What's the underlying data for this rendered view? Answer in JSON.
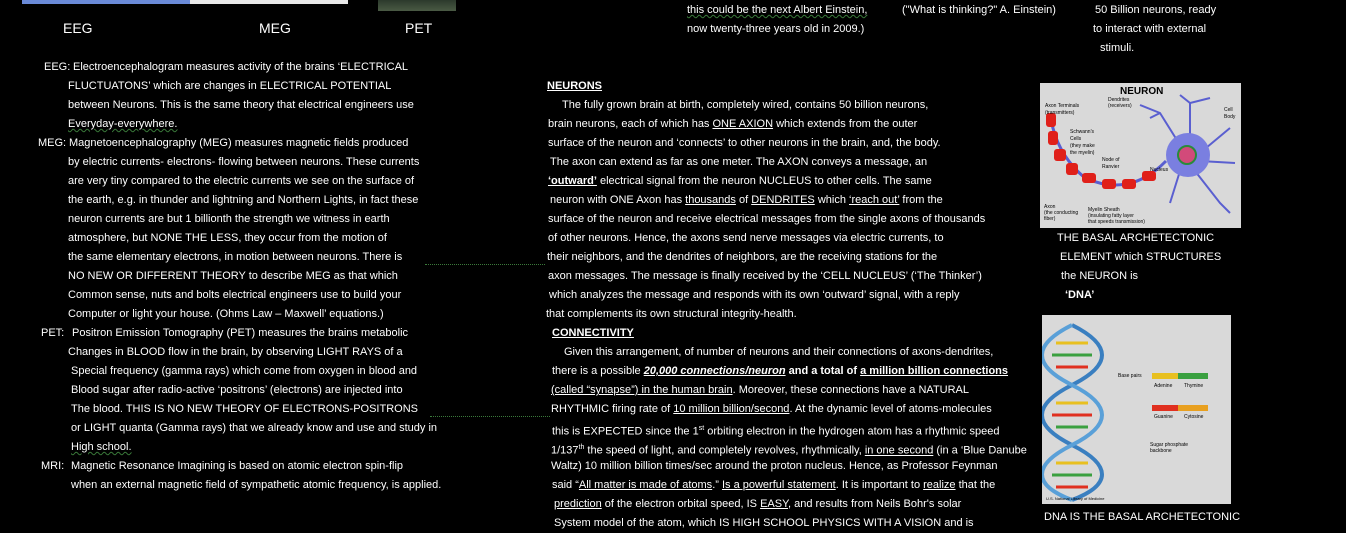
{
  "top_images": {
    "eeg_label": "EEG",
    "meg_label": "MEG",
    "pet_label": "PET"
  },
  "top_quotes": {
    "col1": [
      "this could be the next Albert Einstein,",
      "now twenty-three years old in 2009.)"
    ],
    "col2": [
      "(\"What is thinking?\" A. Einstein)"
    ],
    "col3": [
      "50 Billion neurons, ready",
      "to interact with external",
      "stimuli."
    ]
  },
  "left_column": {
    "eeg": {
      "prefix": "EEG:",
      "lines": [
        "Electroencephalogram measures activity of the brains ‘ELECTRICAL",
        "FLUCTUATONS’ which are changes in ELECTRICAL POTENTIAL",
        "between Neurons.  This is the same theory that electrical engineers use",
        "Everyday-everywhere."
      ]
    },
    "meg": {
      "prefix": "MEG:",
      "lines": [
        "Magnetoencephalography (MEG) measures magnetic fields produced",
        "by electric currents- electrons- flowing between neurons.  These currents",
        "are very tiny compared to the electric currents we see on the surface of",
        "the earth, e.g. in thunder and lightning and Northern Lights, in fact these",
        "neuron currents are but 1 billionth the strength we witness in earth",
        "atmosphere, but NONE THE LESS, they occur from the motion of",
        "the same  elementary electrons, in motion between neurons.  There is",
        "NO NEW OR DIFFERENT THEORY to describe MEG as that which",
        "Common sense, nuts and bolts electrical engineers use to build your",
        "Computer or light your house. (Ohms Law – Maxwell’ equations.)"
      ]
    },
    "pet": {
      "prefix": "PET:",
      "lines": [
        "Positron Emission Tomography (PET) measures the brains metabolic",
        "Changes in BLOOD flow in the brain, by observing LIGHT RAYS of a",
        "Special frequency (gamma rays) which come from oxygen in blood and",
        "Blood sugar after radio-active ‘positrons’ (electrons) are injected into",
        "The blood.  THIS IS NO NEW THEORY OF ELECTRONS-POSITRONS",
        "or LIGHT quanta (Gamma rays) that we already know and use and study in",
        "High school."
      ]
    },
    "mri": {
      "prefix": "MRI:",
      "lines": [
        "Magnetic Resonance Imagining is based on atomic electron spin-flip",
        "when an external magnetic field of sympathetic atomic frequency, is applied."
      ]
    }
  },
  "middle_column": {
    "neurons_heading": "NEURONS",
    "neurons_lines": {
      "l1": "The fully grown brain at birth, completely wired, contains 50 billion neurons,",
      "l2a": "brain neurons, each of which has ",
      "l2b": "ONE AXION",
      "l2c": " which extends from the outer",
      "l3": "surface of the neuron and ‘connects’ to other neurons in the brain, and, the body.",
      "l4": "The axon can extend as far as one meter. The AXON conveys a message, an",
      "l5a": "‘outward’",
      "l5b": " electrical signal from the neuron NUCLEUS to other cells.  The same",
      "l6a": "neuron with ONE Axon has ",
      "l6b": "thousands",
      "l6c": " of ",
      "l6d": "DENDRITES",
      "l6e": " which ",
      "l6f": "‘reach out’",
      "l6g": " from the",
      "l7": "surface of the neuron and receive electrical messages from the single axons of thousands",
      "l8": "of other neurons. Hence, the axons send nerve messages via electric currents, to",
      "l9": "their neighbors, and the dendrites of neighbors, are the receiving stations for the",
      "l10": "axon messages.   The message is finally received by the ‘CELL NUCLEUS’ (‘The Thinker’)",
      "l11": "which analyzes the message and responds with its own ‘outward’ signal, with a reply",
      "l12": "that complements its own structural integrity-health."
    },
    "connectivity_heading": "CONNECTIVITY",
    "connectivity_lines": {
      "c1": "Given this arrangement, of number of neurons and their connections of axons-dendrites,",
      "c2a": "there is a possible ",
      "c2b": "20,000 connections/neuron",
      "c2c": " and a total of ",
      "c2d": "a million billion connections",
      "c3a": "(called “synapse”) in the human brain",
      "c3b": ".  Moreover, these connections have a NATURAL",
      "c4a": "RHYTHMIC firing rate of ",
      "c4b": "10 million billion/second",
      "c4c": ".  At the dynamic level of atoms-molecules",
      "c5a": "this is EXPECTED since the 1",
      "c5sup": "st",
      "c5b": " orbiting electron in the hydrogen atom has a rhythmic speed",
      "c6a": "1/137",
      "c6sup": "th",
      "c6b": " the speed of light, and completely revolves, rhythmically, ",
      "c6c": "in one second",
      "c6d": " (in a ‘Blue Danube",
      "c7": "Waltz) 10 million billion times/sec around the proton nucleus.  Hence, as Professor Feynman",
      "c8a": "said “",
      "c8b": "All matter is made of  atoms",
      "c8c": ".” ",
      "c8d": "Is a powerful statement",
      "c8e": ".  It is important to ",
      "c8f": "realize",
      "c8g": " that the",
      "c9a": "prediction",
      "c9b": " of the electron orbital speed, IS ",
      "c9c": "EASY",
      "c9d": ", and results from Neils Bohr's solar",
      "c10": "System model of the atom, which IS HIGH SCHOOL PHYSICS WITH A VISION and is"
    }
  },
  "right_column": {
    "neuron_figure": {
      "title": "NEURON",
      "labels": [
        "Dendrites",
        "(receivers)",
        "Axon Terminals",
        "(transmitters)",
        "Cell",
        "Body",
        "Schwann's",
        "Cells",
        "(they make",
        "the myelin)",
        "Node of",
        "Ranvier",
        "Nucleus",
        "Axon",
        "(the conducting",
        "fiber)",
        "Myelin Sheath",
        "(insulating fatty layer",
        "that speeds transmission)"
      ]
    },
    "neuron_caption": [
      "THE BASAL ARCHETECTONIC",
      "ELEMENT which STRUCTURES",
      "the NEURON is",
      "‘DNA’"
    ],
    "dna_figure": {
      "labels": [
        "Base pairs",
        "Adenine",
        "Thymine",
        "Guanine",
        "Cytosine",
        "Sugar phosphate",
        "backbone",
        "U.S. National Library of Medicine"
      ]
    },
    "dna_caption": "DNA IS THE BASAL ARCHETECTONIC"
  },
  "colors": {
    "background": "#000000",
    "text": "#ffffff",
    "figure_bg": "#d9d9d9",
    "axon_red": "#e0201a",
    "dendrite_blue": "#5a5fd0",
    "dna_blue": "#3a7fc0"
  }
}
